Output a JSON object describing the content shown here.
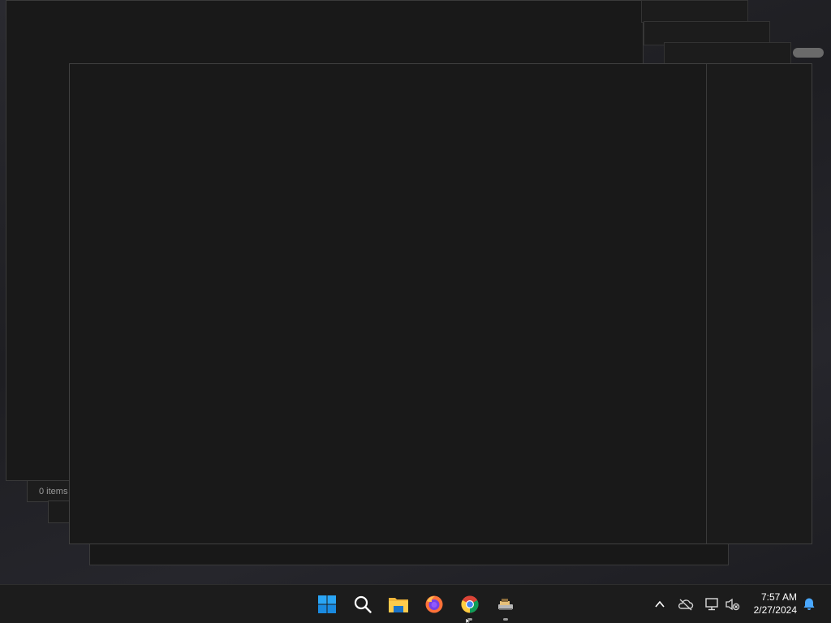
{
  "explorer": {
    "status_text": "0 items"
  },
  "taskbar": {
    "apps": [
      {
        "name": "start",
        "icon": "windows-start-icon"
      },
      {
        "name": "search",
        "icon": "search-icon"
      },
      {
        "name": "file-explorer",
        "icon": "folder-icon"
      },
      {
        "name": "firefox",
        "icon": "firefox-icon"
      },
      {
        "name": "chrome",
        "icon": "chrome-icon",
        "running": true
      },
      {
        "name": "app",
        "icon": "app-icon",
        "running": true
      }
    ],
    "tray": {
      "icons": [
        "chevron-up-icon",
        "cloud-offline-icon",
        "network-icon",
        "volume-muted-icon",
        "notification-bell-icon"
      ]
    },
    "clock": {
      "time": "7:57 AM",
      "date": "2/27/2024"
    }
  },
  "colors": {
    "accent": "#0078d4",
    "window_bg": "#191919",
    "taskbar_bg": "#1c1c1c"
  }
}
